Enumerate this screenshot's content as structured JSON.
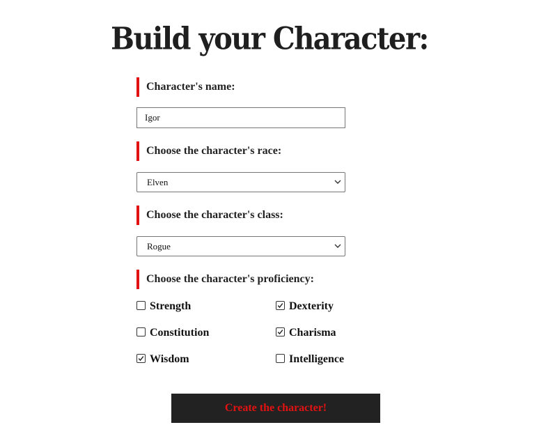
{
  "title": "Build your Character:",
  "fields": {
    "name_label": "Character's name:",
    "name_value": "Igor",
    "race_label": "Choose the character's race:",
    "race_value": "Elven",
    "class_label": "Choose the character's class:",
    "class_value": "Rogue",
    "proficiency_label": "Choose the character's proficiency:"
  },
  "proficiencies": [
    {
      "label": "Strength",
      "checked": false
    },
    {
      "label": "Dexterity",
      "checked": true
    },
    {
      "label": "Constitution",
      "checked": false
    },
    {
      "label": "Charisma",
      "checked": true
    },
    {
      "label": "Wisdom",
      "checked": true
    },
    {
      "label": "Intelligence",
      "checked": false
    }
  ],
  "submit_label": "Create the character!",
  "colors": {
    "accent": "#e31212",
    "button_bg": "#222222",
    "text": "#222222"
  },
  "icons": {
    "select_arrow": "chevron-down-icon",
    "checked_mark": "checkmark-icon"
  }
}
